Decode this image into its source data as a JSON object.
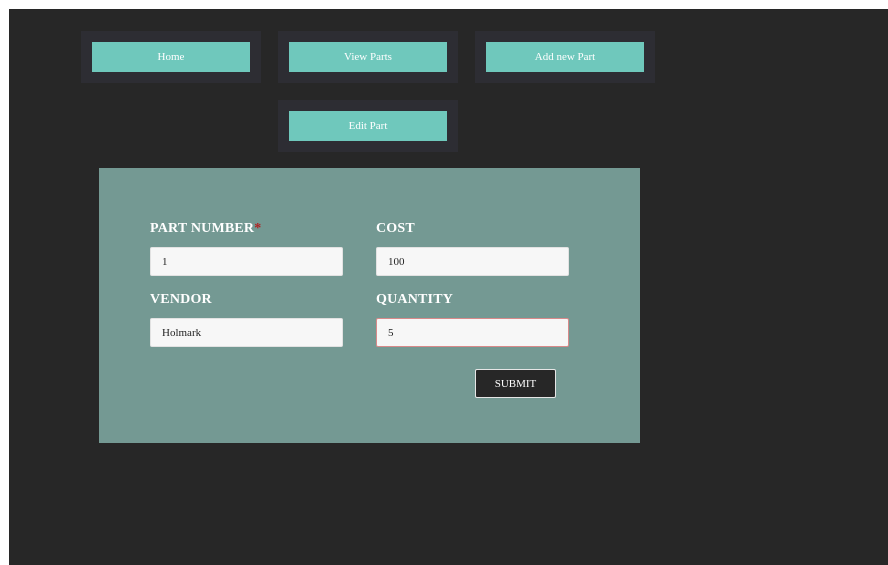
{
  "nav": {
    "home_label": "Home",
    "view_parts_label": "View Parts",
    "add_part_label": "Add new Part",
    "edit_part_label": "Edit Part"
  },
  "form": {
    "part_number": {
      "label": "PART NUMBER",
      "required_mark": "*",
      "value": "1"
    },
    "cost": {
      "label": "COST",
      "value": "100"
    },
    "vendor": {
      "label": "VENDOR",
      "value": "Holmark"
    },
    "quantity": {
      "label": "QUANTITY",
      "value": "5"
    },
    "submit_label": "SUBMIT"
  },
  "colors": {
    "background": "#272727",
    "nav_button": "#6fc8bc",
    "form_panel": "#749993",
    "required": "#b22222"
  }
}
